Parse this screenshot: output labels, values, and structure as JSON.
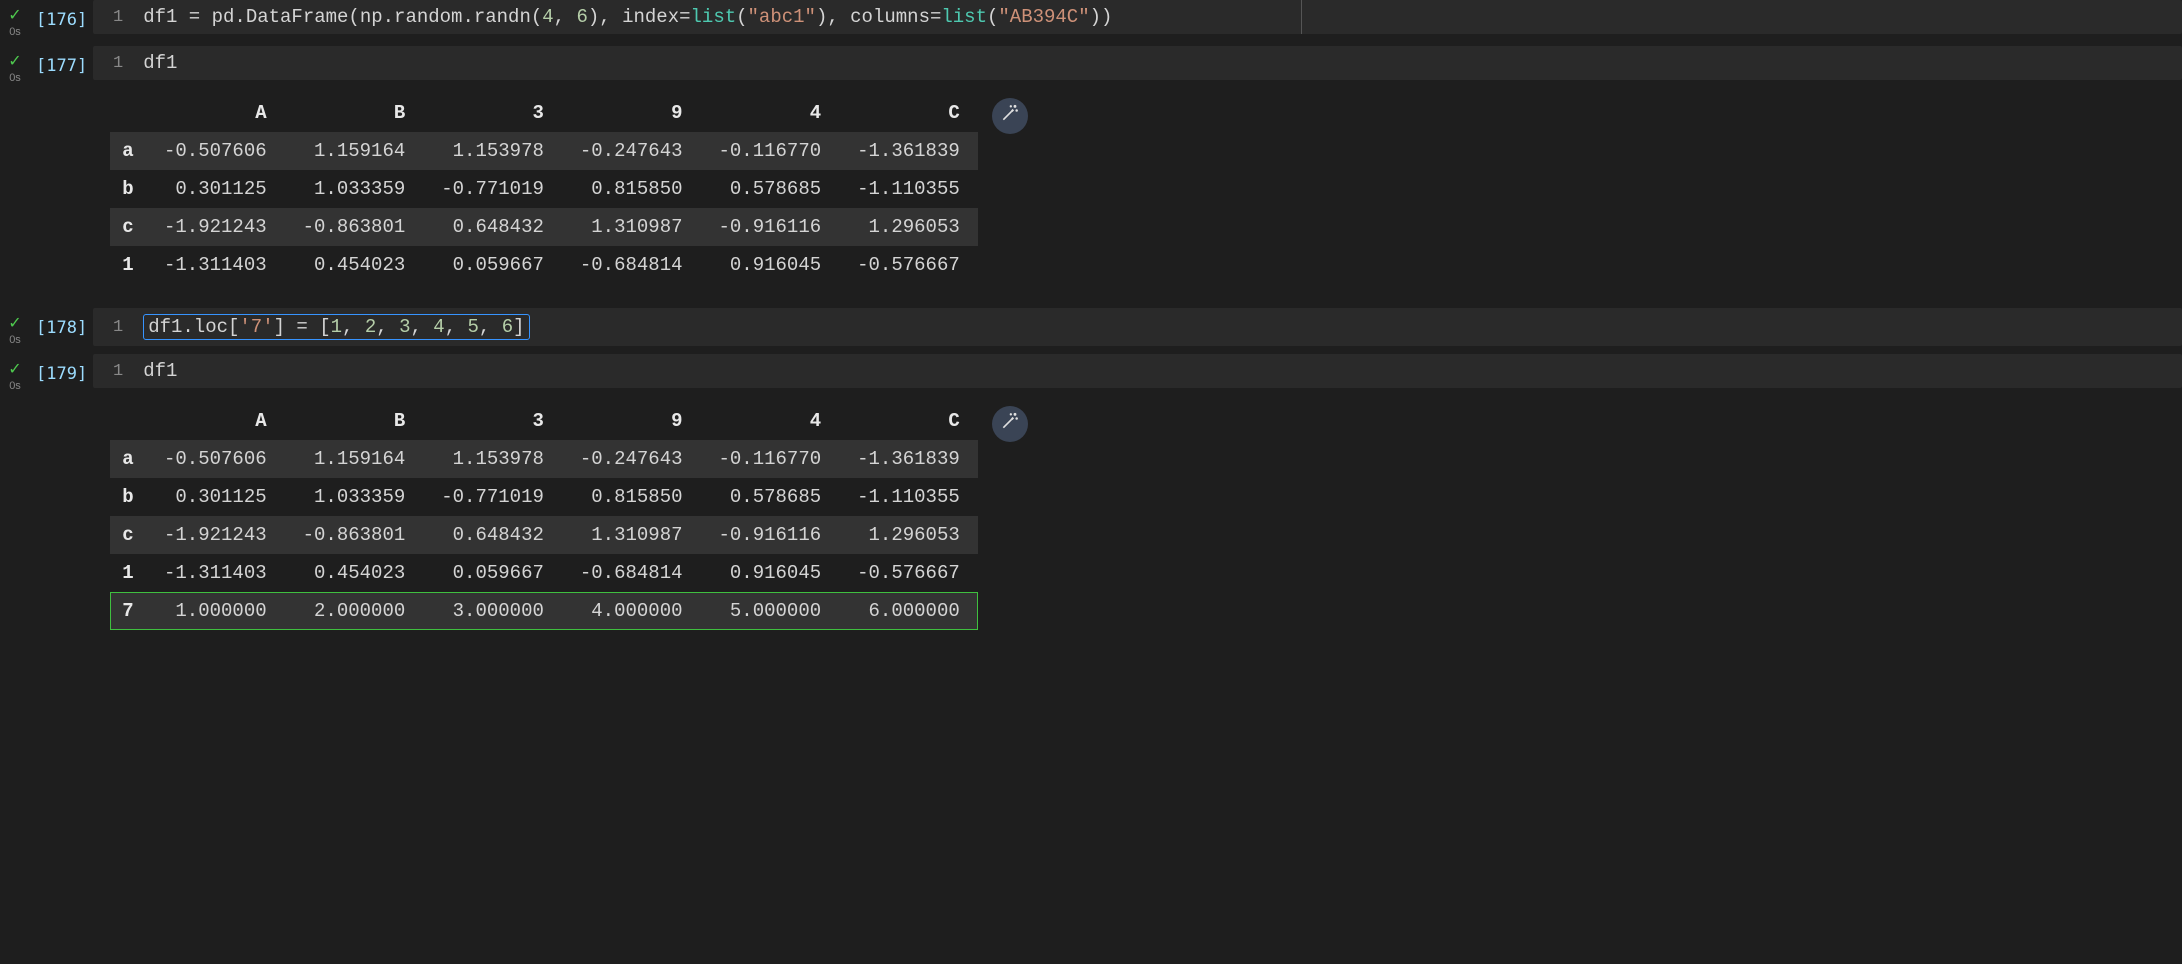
{
  "cells": [
    {
      "exec": "[176]",
      "time": "0s",
      "line": "1",
      "code_tokens": [
        {
          "t": "df1 ",
          "c": "tok-var"
        },
        {
          "t": "= ",
          "c": "tok-op"
        },
        {
          "t": "pd.DataFrame(np.random.randn(",
          "c": "tok-var"
        },
        {
          "t": "4",
          "c": "tok-num"
        },
        {
          "t": ", ",
          "c": "tok-punc"
        },
        {
          "t": "6",
          "c": "tok-num"
        },
        {
          "t": "), index=",
          "c": "tok-var"
        },
        {
          "t": "list",
          "c": "tok-builtin"
        },
        {
          "t": "(",
          "c": "tok-punc"
        },
        {
          "t": "\"abc1\"",
          "c": "tok-str"
        },
        {
          "t": "), columns=",
          "c": "tok-var"
        },
        {
          "t": "list",
          "c": "tok-builtin"
        },
        {
          "t": "(",
          "c": "tok-punc"
        },
        {
          "t": "\"AB394C\"",
          "c": "tok-str"
        },
        {
          "t": "))",
          "c": "tok-punc"
        }
      ],
      "with_split": true
    },
    {
      "exec": "[177]",
      "time": "0s",
      "line": "1",
      "code_tokens": [
        {
          "t": "df1",
          "c": "tok-var"
        }
      ],
      "output_table": 0
    },
    {
      "exec": "[178]",
      "time": "0s",
      "line": "1",
      "highlighted": true,
      "code_tokens": [
        {
          "t": "df1.loc[",
          "c": "tok-var"
        },
        {
          "t": "'7'",
          "c": "tok-str"
        },
        {
          "t": "] = [",
          "c": "tok-var"
        },
        {
          "t": "1",
          "c": "tok-num"
        },
        {
          "t": ", ",
          "c": "tok-punc"
        },
        {
          "t": "2",
          "c": "tok-num"
        },
        {
          "t": ", ",
          "c": "tok-punc"
        },
        {
          "t": "3",
          "c": "tok-num"
        },
        {
          "t": ", ",
          "c": "tok-punc"
        },
        {
          "t": "4",
          "c": "tok-num"
        },
        {
          "t": ", ",
          "c": "tok-punc"
        },
        {
          "t": "5",
          "c": "tok-num"
        },
        {
          "t": ", ",
          "c": "tok-punc"
        },
        {
          "t": "6",
          "c": "tok-num"
        },
        {
          "t": "]",
          "c": "tok-punc"
        }
      ]
    },
    {
      "exec": "[179]",
      "time": "0s",
      "line": "1",
      "code_tokens": [
        {
          "t": "df1",
          "c": "tok-var"
        }
      ],
      "output_table": 1
    }
  ],
  "tables": [
    {
      "columns": [
        "A",
        "B",
        "3",
        "9",
        "4",
        "C"
      ],
      "index": [
        "a",
        "b",
        "c",
        "1"
      ],
      "data": [
        [
          "-0.507606",
          "1.159164",
          "1.153978",
          "-0.247643",
          "-0.116770",
          "-1.361839"
        ],
        [
          "0.301125",
          "1.033359",
          "-0.771019",
          "0.815850",
          "0.578685",
          "-1.110355"
        ],
        [
          "-1.921243",
          "-0.863801",
          "0.648432",
          "1.310987",
          "-0.916116",
          "1.296053"
        ],
        [
          "-1.311403",
          "0.454023",
          "0.059667",
          "-0.684814",
          "0.916045",
          "-0.576667"
        ]
      ],
      "highlight_row": null
    },
    {
      "columns": [
        "A",
        "B",
        "3",
        "9",
        "4",
        "C"
      ],
      "index": [
        "a",
        "b",
        "c",
        "1",
        "7"
      ],
      "data": [
        [
          "-0.507606",
          "1.159164",
          "1.153978",
          "-0.247643",
          "-0.116770",
          "-1.361839"
        ],
        [
          "0.301125",
          "1.033359",
          "-0.771019",
          "0.815850",
          "0.578685",
          "-1.110355"
        ],
        [
          "-1.921243",
          "-0.863801",
          "0.648432",
          "1.310987",
          "-0.916116",
          "1.296053"
        ],
        [
          "-1.311403",
          "0.454023",
          "0.059667",
          "-0.684814",
          "0.916045",
          "-0.576667"
        ],
        [
          "1.000000",
          "2.000000",
          "3.000000",
          "4.000000",
          "5.000000",
          "6.000000"
        ]
      ],
      "highlight_row": 4
    }
  ],
  "icons": {
    "wand_tooltip": "Suggest charts"
  },
  "chart_data": [
    {
      "type": "table",
      "title": "df1 (cell 177)",
      "columns": [
        "A",
        "B",
        "3",
        "9",
        "4",
        "C"
      ],
      "index": [
        "a",
        "b",
        "c",
        "1"
      ],
      "values": [
        [
          -0.507606,
          1.159164,
          1.153978,
          -0.247643,
          -0.11677,
          -1.361839
        ],
        [
          0.301125,
          1.033359,
          -0.771019,
          0.81585,
          0.578685,
          -1.110355
        ],
        [
          -1.921243,
          -0.863801,
          0.648432,
          1.310987,
          -0.916116,
          1.296053
        ],
        [
          -1.311403,
          0.454023,
          0.059667,
          -0.684814,
          0.916045,
          -0.576667
        ]
      ]
    },
    {
      "type": "table",
      "title": "df1 (cell 179, after insert row '7')",
      "columns": [
        "A",
        "B",
        "3",
        "9",
        "4",
        "C"
      ],
      "index": [
        "a",
        "b",
        "c",
        "1",
        "7"
      ],
      "values": [
        [
          -0.507606,
          1.159164,
          1.153978,
          -0.247643,
          -0.11677,
          -1.361839
        ],
        [
          0.301125,
          1.033359,
          -0.771019,
          0.81585,
          0.578685,
          -1.110355
        ],
        [
          -1.921243,
          -0.863801,
          0.648432,
          1.310987,
          -0.916116,
          1.296053
        ],
        [
          -1.311403,
          0.454023,
          0.059667,
          -0.684814,
          0.916045,
          -0.576667
        ],
        [
          1.0,
          2.0,
          3.0,
          4.0,
          5.0,
          6.0
        ]
      ]
    }
  ]
}
